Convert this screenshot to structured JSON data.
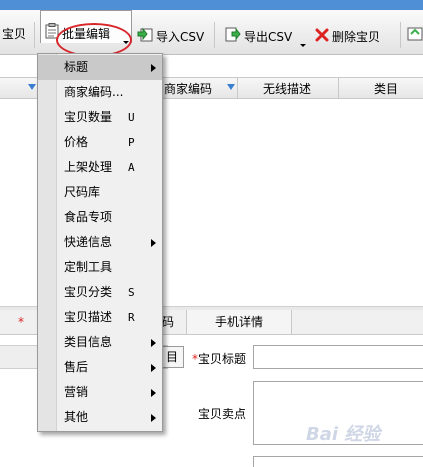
{
  "toolbar": {
    "left_partial_label": "宝贝",
    "batch_edit_label": "批量编辑",
    "import_csv_label": "导入CSV",
    "export_csv_label": "导出CSV",
    "delete_label": "删除宝贝"
  },
  "grid": {
    "headers": [
      "商家编码",
      "无线描述",
      "类目"
    ]
  },
  "menu": {
    "items": [
      {
        "label": "标题",
        "key": "",
        "submenu": true,
        "highlighted": true
      },
      {
        "label": "商家编码...",
        "key": "",
        "submenu": false
      },
      {
        "label": "宝贝数量",
        "key": "U",
        "submenu": false
      },
      {
        "label": "价格",
        "key": "P",
        "submenu": false
      },
      {
        "label": "上架处理",
        "key": "A",
        "submenu": false
      },
      {
        "label": "尺码库",
        "key": "",
        "submenu": false
      },
      {
        "label": "食品专项",
        "key": "",
        "submenu": false
      },
      {
        "label": "快递信息",
        "key": "",
        "submenu": true
      },
      {
        "label": "定制工具",
        "key": "",
        "submenu": false
      },
      {
        "label": "宝贝分类",
        "key": "S",
        "submenu": false
      },
      {
        "label": "宝贝描述",
        "key": "R",
        "submenu": false
      },
      {
        "label": "类目信息",
        "key": "",
        "submenu": true
      },
      {
        "label": "售后",
        "key": "",
        "submenu": true
      },
      {
        "label": "营销",
        "key": "",
        "submenu": true
      },
      {
        "label": "其他",
        "key": "",
        "submenu": true
      }
    ]
  },
  "tabs": {
    "asterisk": "*",
    "partial_tab": "码",
    "mobile_detail": "手机详情"
  },
  "form": {
    "small_button": "目",
    "title_required": "*",
    "title_label": "宝贝标题",
    "selling_point_label": "宝贝卖点"
  },
  "watermark": "Bai 经验",
  "colors": {
    "accent_blue": "#4f8fd6",
    "highlight_oval": "#d8262b"
  }
}
